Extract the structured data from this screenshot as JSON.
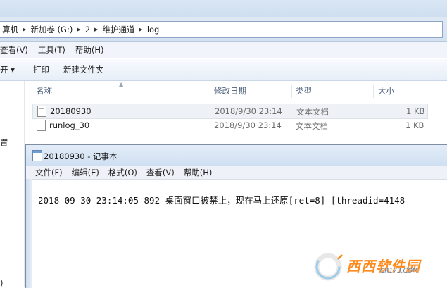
{
  "explorer": {
    "breadcrumb": [
      "算机",
      "新加卷 (G:)",
      "2",
      "维护通道",
      "log"
    ],
    "menu": [
      "查看(V)",
      "工具(T)",
      "帮助(H)"
    ],
    "toolbar": {
      "open_label": "开 ▾",
      "print_label": "打印",
      "new_folder_label": "新建文件夹"
    },
    "nav_fragments": [
      "置",
      ")"
    ],
    "columns": {
      "name": "名称",
      "modified": "修改日期",
      "type": "类型",
      "size": "大小"
    },
    "files": [
      {
        "name": "20180930",
        "modified": "2018/9/30 23:14",
        "type": "文本文档",
        "size": "1 KB"
      },
      {
        "name": "runlog_30",
        "modified": "2018/9/30 23:14",
        "type": "文本文档",
        "size": "1 KB"
      }
    ]
  },
  "notepad": {
    "title": "20180930 - 记事本",
    "menu": [
      "文件(F)",
      "编辑(E)",
      "格式(O)",
      "查看(V)",
      "帮助(H)"
    ],
    "content": "2018-09-30 23:14:05 892  桌面窗口被禁止，现在马上还原[ret=8] [threadid=4148"
  },
  "watermark": {
    "main": "西西软件园",
    "sub": "CR173.COM"
  },
  "colors": {
    "accent": "#4c607a",
    "watermark": "#ff8a1d"
  }
}
